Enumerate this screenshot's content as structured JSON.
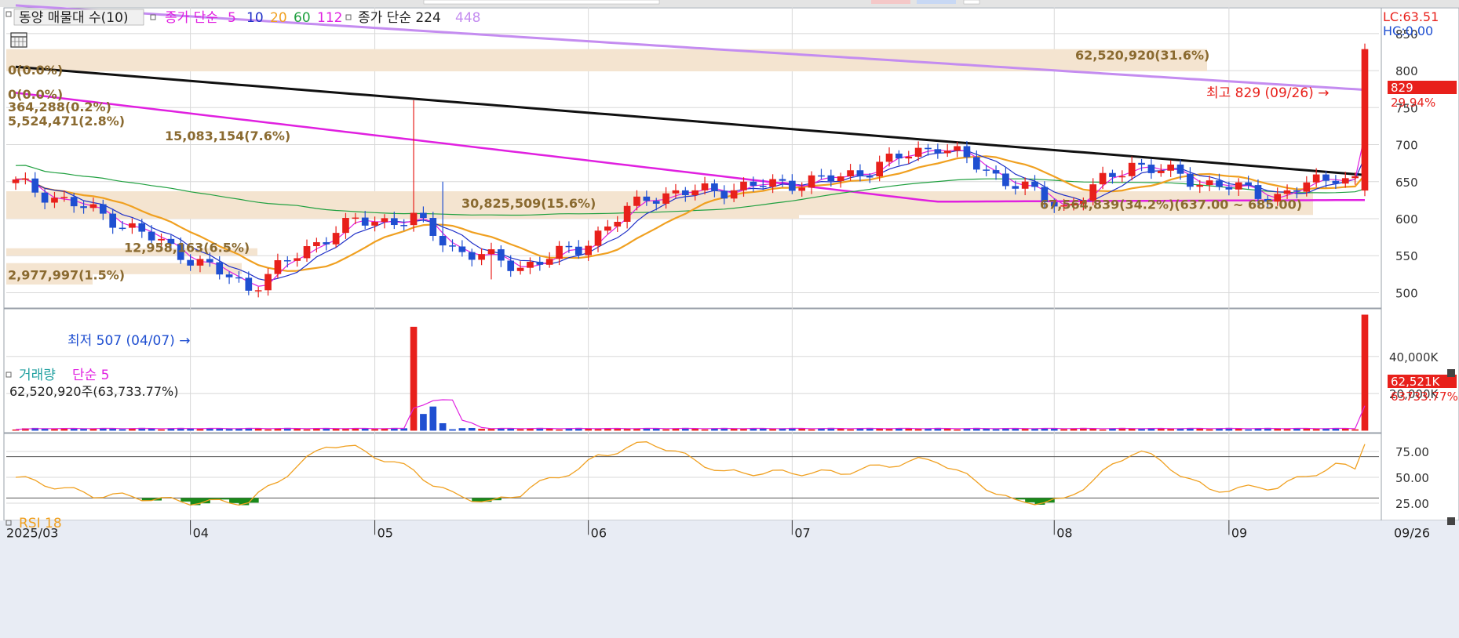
{
  "colors": {
    "up": "#e8201b",
    "down": "#1f4fd1",
    "ma5": "#e020e0",
    "ma10": "#2030c8",
    "ma20": "#f0a020",
    "ma60": "#20a040",
    "ma112": "#e020e0",
    "ma224": "#101010",
    "ma448": "#c48cf0",
    "rsi": "#f0a020",
    "band": "#f4e4d0",
    "bandText": "#8a6a30",
    "grid": "#d8d8d8",
    "axisBg": "#e8ecf4"
  },
  "header": {
    "stock_label": "동양 매물대 수(10)",
    "price_ma_label": "종가 단순",
    "ma_periods": [
      "5",
      "10",
      "20",
      "60",
      "112"
    ],
    "price_ma2_label": "종가 단순 224",
    "ma448_label": "448",
    "lc": "LC:63.51",
    "hc": "HC:0.00"
  },
  "price_panel": {
    "high_annotation": "최고 829 (09/26) →",
    "low_annotation": "최저 507 (04/07) →",
    "last_price": "829",
    "last_change": "29.94%"
  },
  "volume_panel": {
    "label": "거래량",
    "ma_label": "단순 5",
    "value_text": "62,520,920주(63,733.77%)",
    "badge": "62,521K",
    "badge_sub": "63733.77%"
  },
  "rsi_panel": {
    "label": "RSI 18"
  },
  "chart_data": [
    {
      "type": "candlestick",
      "name": "price",
      "y_ticks": [
        "850",
        "800",
        "750",
        "700",
        "650",
        "600",
        "550",
        "500"
      ],
      "ylim": [
        480,
        885
      ],
      "x_ticks": [
        "2025/03",
        "04",
        "05",
        "06",
        "07",
        "08",
        "09",
        "09/26"
      ],
      "high": {
        "value": 829,
        "date": "09/26"
      },
      "low": {
        "value": 507,
        "date": "04/07"
      },
      "volume_profile": [
        "62,520,920(31.6%)",
        "0(0.0%)",
        "0(0.0%)",
        "364,288(0.2%)",
        "5,524,471(2.8%)",
        "15,083,154(7.6%)",
        "67,564,839(34.2%)(637.00 ~ 685.00)",
        "30,825,509(15.6%)",
        "12,958,163(6.5%)",
        "2,977,997(1.5%)"
      ]
    },
    {
      "type": "bar",
      "name": "volume",
      "y_ticks": [
        "40,000K",
        "20,000K"
      ],
      "ylim": [
        0,
        65000
      ],
      "spikes": [
        {
          "month": "05",
          "approx_k": 56000
        },
        {
          "month": "09/26",
          "approx_k": 62521
        }
      ]
    },
    {
      "type": "line",
      "name": "RSI 18",
      "y_ticks": [
        "75.00",
        "50.00",
        "25.00"
      ],
      "ylim": [
        10,
        92
      ],
      "ref_lines": [
        70,
        30
      ],
      "last": 82
    }
  ]
}
